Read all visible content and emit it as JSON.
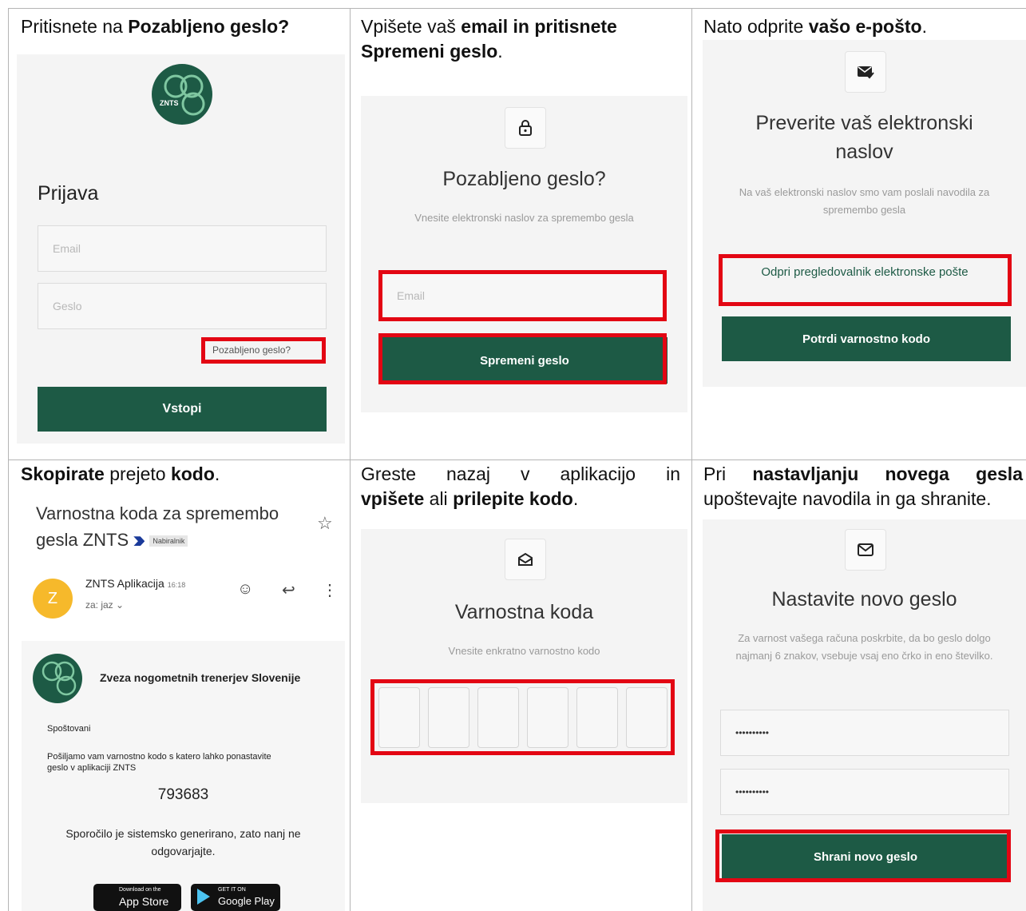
{
  "cells": {
    "c1": {
      "caption_pre": "Pritisnete na ",
      "caption_bold": "Pozabljeno geslo?",
      "logo_text": "ZNTS",
      "heading": "Prijava",
      "email_placeholder": "Email",
      "password_placeholder": "Geslo",
      "forgot_link": "Pozabljeno geslo?",
      "submit_label": "Vstopi"
    },
    "c2": {
      "caption_pre": "Vpišete vaš ",
      "caption_bold": "email in pritisnete Spremeni geslo",
      "caption_post": ".",
      "title": "Pozabljeno geslo?",
      "subtitle": "Vnesite elektronski naslov za spremembo gesla",
      "email_placeholder": "Email",
      "submit_label": "Spremeni geslo"
    },
    "c3": {
      "caption_pre": "Nato odprite ",
      "caption_bold": "vašo e-pošto",
      "caption_post": ".",
      "title": "Preverite vaš elektronski naslov",
      "subtitle": "Na vaš elektronski naslov smo vam poslali navodila za spremembo gesla",
      "open_mail_label": "Odpri pregledovalnik elektronske pošte",
      "confirm_label": "Potrdi varnostno kodo"
    },
    "c4": {
      "caption_bold1": "Skopirate",
      "caption_mid": " prejeto ",
      "caption_bold2": "kodo",
      "caption_post": ".",
      "subject": "Varnostna koda za spremembo gesla ZNTS",
      "inbox_label": "Nabiralnik",
      "avatar_letter": "Z",
      "sender": "ZNTS Aplikacija",
      "time": "16:18",
      "to_me": "za: jaz",
      "org_name": "Zveza nogometnih trenerjev Slovenije",
      "greeting": "Spoštovani",
      "body": "Pošiljamo vam varnostno kodo s katero lahko ponastavite geslo v aplikaciji ZNTS",
      "code": "793683",
      "footer": "Sporočilo je sistemsko generirano, zato nanj ne odgovarjajte.",
      "appstore_small": "Download on the",
      "appstore_big": "App Store",
      "googleplay_small": "GET IT ON",
      "googleplay_big": "Google Play"
    },
    "c5": {
      "caption_line1": "Greste nazaj v aplikacijo in",
      "caption_bold1": "vpišete",
      "caption_mid": " ali ",
      "caption_bold2": "prilepite kodo",
      "caption_post": ".",
      "title": "Varnostna koda",
      "subtitle": "Vnesite enkratno varnostno kodo"
    },
    "c6": {
      "caption_pre": "Pri ",
      "caption_bold": "nastavljanju novega gesla",
      "caption_line2": "upoštevajte navodila in ga shranite.",
      "title": "Nastavite novo geslo",
      "subtitle": "Za varnost vašega računa poskrbite, da bo geslo dolgo najmanj 6 znakov, vsebuje vsaj eno črko in eno številko.",
      "password1": "••••••••••",
      "password2": "••••••••••",
      "submit_label": "Shrani novo geslo"
    }
  },
  "colors": {
    "brand_green": "#1d5a45",
    "highlight_red": "#e30613",
    "avatar_yellow": "#f6b92b"
  }
}
